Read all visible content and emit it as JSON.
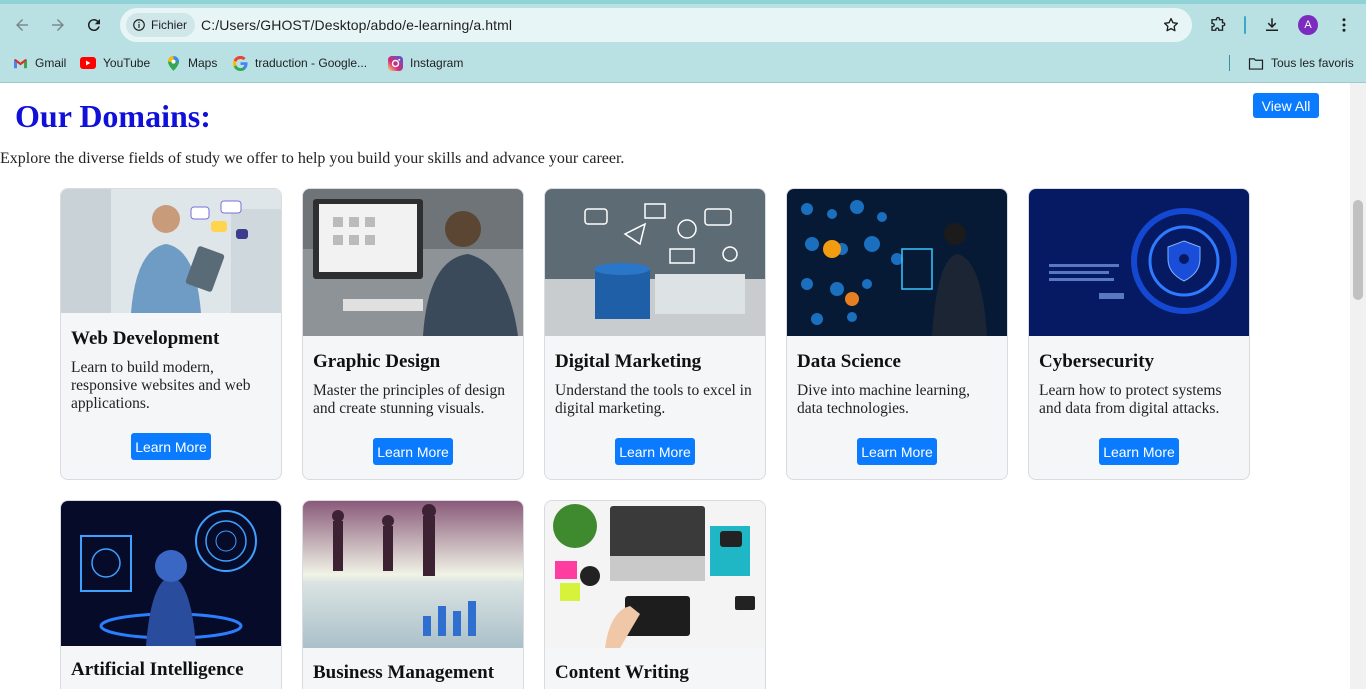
{
  "browser": {
    "site_chip": "Fichier",
    "url": "C:/Users/GHOST/Desktop/abdo/e-learning/a.html",
    "avatar_letter": "A",
    "bookmarks": [
      "Gmail",
      "YouTube",
      "Maps",
      "traduction - Google...",
      "Instagram"
    ],
    "all_bookmarks": "Tous les favoris"
  },
  "page": {
    "title": "Our Domains:",
    "view_all": "View All",
    "description": "Explore the diverse fields of study we offer to help you build your skills and advance your career.",
    "learn_more": "Learn More",
    "cards": [
      {
        "title": "Web Development",
        "text": "Learn to build modern, responsive websites and web applications."
      },
      {
        "title": "Graphic Design",
        "text": "Master the principles of design and create stunning visuals."
      },
      {
        "title": "Digital Marketing",
        "text": "Understand the tools to excel in digital marketing."
      },
      {
        "title": "Data Science",
        "text": "Dive into machine learning, data technologies."
      },
      {
        "title": "Cybersecurity",
        "text": "Learn how to protect systems and data from digital attacks."
      },
      {
        "title": "Artificial Intelligence",
        "text": ""
      },
      {
        "title": "Business Management",
        "text": ""
      },
      {
        "title": "Content Writing",
        "text": ""
      }
    ]
  },
  "colors": {
    "title_blue": "#1010d8",
    "button_blue": "#0a7bff",
    "chrome_teal": "#b9e1e4",
    "card_bg": "#f5f6f8"
  }
}
